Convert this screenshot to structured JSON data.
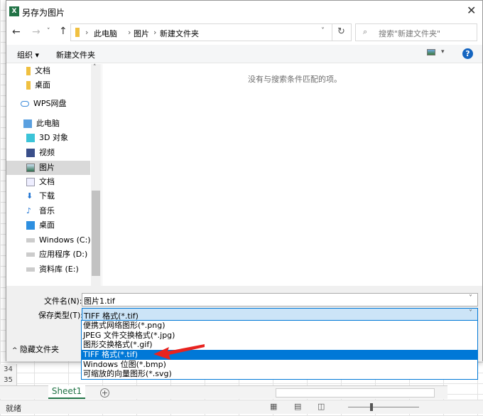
{
  "dialog": {
    "title": "另存为图片",
    "close_icon": "close-icon"
  },
  "address": {
    "path": [
      "此电脑",
      "图片",
      "新建文件夹"
    ],
    "search_placeholder": "搜索\"新建文件夹\""
  },
  "toolbar": {
    "organize": "组织",
    "new_folder": "新建文件夹"
  },
  "nav": {
    "items": [
      {
        "label": "文档",
        "icon": "folder-icon"
      },
      {
        "label": "桌面",
        "icon": "folder-icon"
      },
      {
        "label": "WPS网盘",
        "icon": "cloud-icon"
      },
      {
        "label": "此电脑",
        "icon": "computer-icon"
      },
      {
        "label": "3D 对象",
        "icon": "cube-icon"
      },
      {
        "label": "视频",
        "icon": "video-icon"
      },
      {
        "label": "图片",
        "icon": "pictures-icon",
        "selected": true
      },
      {
        "label": "文档",
        "icon": "document-icon"
      },
      {
        "label": "下载",
        "icon": "download-icon"
      },
      {
        "label": "音乐",
        "icon": "music-icon"
      },
      {
        "label": "桌面",
        "icon": "desktop-icon"
      },
      {
        "label": "Windows (C:)",
        "icon": "drive-icon"
      },
      {
        "label": "应用程序 (D:)",
        "icon": "drive-icon"
      },
      {
        "label": "资料库 (E:)",
        "icon": "drive-icon"
      }
    ]
  },
  "content": {
    "empty_message": "没有与搜索条件匹配的项。"
  },
  "form": {
    "filename_label": "文件名(N):",
    "filename_value": "图片1.tif",
    "type_label": "保存类型(T):",
    "type_value": "TIFF 格式(*.tif)",
    "hide_folders": "隐藏文件夹"
  },
  "type_options": [
    "便携式网络图形(*.png)",
    "JPEG 文件交换格式(*.jpg)",
    "图形交换格式(*.gif)",
    "TIFF 格式(*.tif)",
    "Windows 位图(*.bmp)",
    "可缩放的向量图形(*.svg)"
  ],
  "selected_option_index": 3,
  "excel": {
    "rows": [
      "34",
      "35"
    ],
    "sheet_tab": "Sheet1",
    "status": "就绪"
  },
  "colors": {
    "accent": "#0078d7",
    "select_bg": "#cce4f7",
    "annotation_arrow": "#e8231f",
    "excel_green": "#217346"
  }
}
